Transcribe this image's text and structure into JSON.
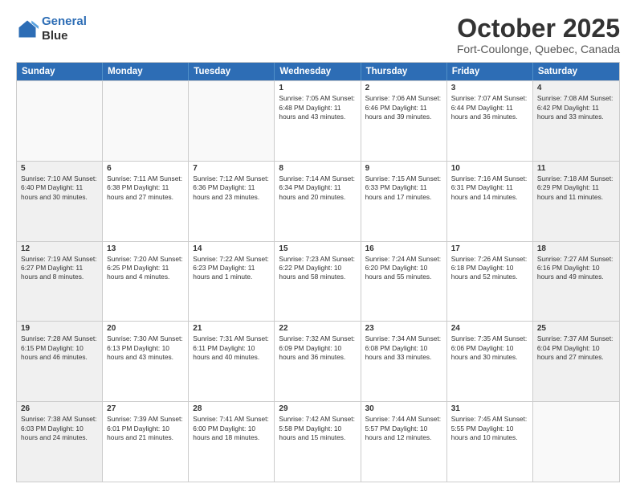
{
  "header": {
    "logo_line1": "General",
    "logo_line2": "Blue",
    "month": "October 2025",
    "location": "Fort-Coulonge, Quebec, Canada"
  },
  "days_of_week": [
    "Sunday",
    "Monday",
    "Tuesday",
    "Wednesday",
    "Thursday",
    "Friday",
    "Saturday"
  ],
  "rows": [
    {
      "cells": [
        {
          "day": "",
          "text": "",
          "empty": true
        },
        {
          "day": "",
          "text": "",
          "empty": true
        },
        {
          "day": "",
          "text": "",
          "empty": true
        },
        {
          "day": "1",
          "text": "Sunrise: 7:05 AM\nSunset: 6:48 PM\nDaylight: 11 hours\nand 43 minutes.",
          "shaded": false
        },
        {
          "day": "2",
          "text": "Sunrise: 7:06 AM\nSunset: 6:46 PM\nDaylight: 11 hours\nand 39 minutes.",
          "shaded": false
        },
        {
          "day": "3",
          "text": "Sunrise: 7:07 AM\nSunset: 6:44 PM\nDaylight: 11 hours\nand 36 minutes.",
          "shaded": false
        },
        {
          "day": "4",
          "text": "Sunrise: 7:08 AM\nSunset: 6:42 PM\nDaylight: 11 hours\nand 33 minutes.",
          "shaded": true
        }
      ]
    },
    {
      "cells": [
        {
          "day": "5",
          "text": "Sunrise: 7:10 AM\nSunset: 6:40 PM\nDaylight: 11 hours\nand 30 minutes.",
          "shaded": true
        },
        {
          "day": "6",
          "text": "Sunrise: 7:11 AM\nSunset: 6:38 PM\nDaylight: 11 hours\nand 27 minutes.",
          "shaded": false
        },
        {
          "day": "7",
          "text": "Sunrise: 7:12 AM\nSunset: 6:36 PM\nDaylight: 11 hours\nand 23 minutes.",
          "shaded": false
        },
        {
          "day": "8",
          "text": "Sunrise: 7:14 AM\nSunset: 6:34 PM\nDaylight: 11 hours\nand 20 minutes.",
          "shaded": false
        },
        {
          "day": "9",
          "text": "Sunrise: 7:15 AM\nSunset: 6:33 PM\nDaylight: 11 hours\nand 17 minutes.",
          "shaded": false
        },
        {
          "day": "10",
          "text": "Sunrise: 7:16 AM\nSunset: 6:31 PM\nDaylight: 11 hours\nand 14 minutes.",
          "shaded": false
        },
        {
          "day": "11",
          "text": "Sunrise: 7:18 AM\nSunset: 6:29 PM\nDaylight: 11 hours\nand 11 minutes.",
          "shaded": true
        }
      ]
    },
    {
      "cells": [
        {
          "day": "12",
          "text": "Sunrise: 7:19 AM\nSunset: 6:27 PM\nDaylight: 11 hours\nand 8 minutes.",
          "shaded": true
        },
        {
          "day": "13",
          "text": "Sunrise: 7:20 AM\nSunset: 6:25 PM\nDaylight: 11 hours\nand 4 minutes.",
          "shaded": false
        },
        {
          "day": "14",
          "text": "Sunrise: 7:22 AM\nSunset: 6:23 PM\nDaylight: 11 hours\nand 1 minute.",
          "shaded": false
        },
        {
          "day": "15",
          "text": "Sunrise: 7:23 AM\nSunset: 6:22 PM\nDaylight: 10 hours\nand 58 minutes.",
          "shaded": false
        },
        {
          "day": "16",
          "text": "Sunrise: 7:24 AM\nSunset: 6:20 PM\nDaylight: 10 hours\nand 55 minutes.",
          "shaded": false
        },
        {
          "day": "17",
          "text": "Sunrise: 7:26 AM\nSunset: 6:18 PM\nDaylight: 10 hours\nand 52 minutes.",
          "shaded": false
        },
        {
          "day": "18",
          "text": "Sunrise: 7:27 AM\nSunset: 6:16 PM\nDaylight: 10 hours\nand 49 minutes.",
          "shaded": true
        }
      ]
    },
    {
      "cells": [
        {
          "day": "19",
          "text": "Sunrise: 7:28 AM\nSunset: 6:15 PM\nDaylight: 10 hours\nand 46 minutes.",
          "shaded": true
        },
        {
          "day": "20",
          "text": "Sunrise: 7:30 AM\nSunset: 6:13 PM\nDaylight: 10 hours\nand 43 minutes.",
          "shaded": false
        },
        {
          "day": "21",
          "text": "Sunrise: 7:31 AM\nSunset: 6:11 PM\nDaylight: 10 hours\nand 40 minutes.",
          "shaded": false
        },
        {
          "day": "22",
          "text": "Sunrise: 7:32 AM\nSunset: 6:09 PM\nDaylight: 10 hours\nand 36 minutes.",
          "shaded": false
        },
        {
          "day": "23",
          "text": "Sunrise: 7:34 AM\nSunset: 6:08 PM\nDaylight: 10 hours\nand 33 minutes.",
          "shaded": false
        },
        {
          "day": "24",
          "text": "Sunrise: 7:35 AM\nSunset: 6:06 PM\nDaylight: 10 hours\nand 30 minutes.",
          "shaded": false
        },
        {
          "day": "25",
          "text": "Sunrise: 7:37 AM\nSunset: 6:04 PM\nDaylight: 10 hours\nand 27 minutes.",
          "shaded": true
        }
      ]
    },
    {
      "cells": [
        {
          "day": "26",
          "text": "Sunrise: 7:38 AM\nSunset: 6:03 PM\nDaylight: 10 hours\nand 24 minutes.",
          "shaded": true
        },
        {
          "day": "27",
          "text": "Sunrise: 7:39 AM\nSunset: 6:01 PM\nDaylight: 10 hours\nand 21 minutes.",
          "shaded": false
        },
        {
          "day": "28",
          "text": "Sunrise: 7:41 AM\nSunset: 6:00 PM\nDaylight: 10 hours\nand 18 minutes.",
          "shaded": false
        },
        {
          "day": "29",
          "text": "Sunrise: 7:42 AM\nSunset: 5:58 PM\nDaylight: 10 hours\nand 15 minutes.",
          "shaded": false
        },
        {
          "day": "30",
          "text": "Sunrise: 7:44 AM\nSunset: 5:57 PM\nDaylight: 10 hours\nand 12 minutes.",
          "shaded": false
        },
        {
          "day": "31",
          "text": "Sunrise: 7:45 AM\nSunset: 5:55 PM\nDaylight: 10 hours\nand 10 minutes.",
          "shaded": false
        },
        {
          "day": "",
          "text": "",
          "empty": true
        }
      ]
    }
  ]
}
